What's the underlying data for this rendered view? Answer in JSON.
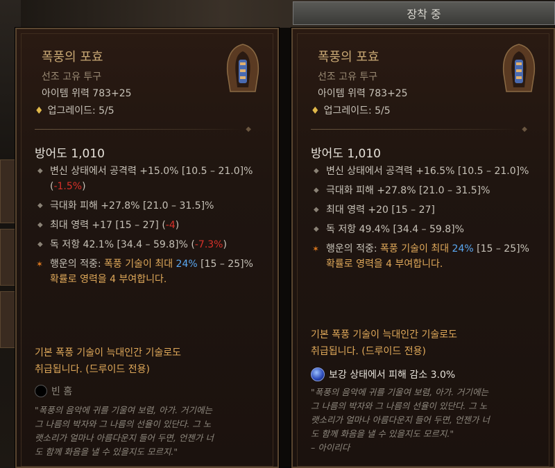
{
  "header": {
    "equipped_tab": "장착 중"
  },
  "left": {
    "title": "폭풍의 포효",
    "type": "선조 고유 투구",
    "power": "아이템 위력 783+25",
    "upgrade": "업그레이드: 5/5",
    "armor": "방어도 1,010",
    "stats": [
      {
        "pre": "변신 상태에서 공격력 +15.0% [10.5 – 21.0]% (",
        "diff": "-1.5%",
        "post": ")"
      },
      {
        "pre": "극대화 피해 +27.8% [21.0 – 31.5]%",
        "diff": "",
        "post": ""
      },
      {
        "pre": "최대 영력 +17 [15 – 27] (",
        "diff": "-4",
        "post": ")"
      },
      {
        "pre": "독 저항 42.1% [34.4 – 59.8]% (",
        "diff": "-7.3%",
        "post": ")"
      }
    ],
    "aspect_pre": "행운의 적중: ",
    "aspect_storm": "폭풍 기술이 최대 ",
    "aspect_pct": "24%",
    "aspect_mid": "[15 – 25]% ",
    "aspect_post": "확률로 영력을 4 부여합니다.",
    "druid_a": "기본 폭풍 기술이 늑대인간 기술로도",
    "druid_b": "취급됩니다. (드루이드 전용)",
    "socket": "빈 홈",
    "flavor": [
      "\"폭풍의 음악에 귀를 기울여 보렴, 아가. 거기에는",
      "그 나름의 박자와 그 나름의 선율이 있단다. 그 노",
      "랫소리가 얼마나 아름다운지 들어 두면, 언젠가 너",
      "도 함께 화음을 낼 수 있을지도 모르지.\""
    ]
  },
  "right": {
    "title": "폭풍의 포효",
    "type": "선조 고유 투구",
    "power": "아이템 위력 783+25",
    "upgrade": "업그레이드: 5/5",
    "armor": "방어도 1,010",
    "stats": [
      "변신 상태에서 공격력 +16.5% [10.5 – 21.0]%",
      "극대화 피해 +27.8% [21.0 – 31.5]%",
      "최대 영력 +20 [15 – 27]",
      "독 저항 49.4% [34.4 – 59.8]%"
    ],
    "aspect_pre": "행운의 적중: ",
    "aspect_storm": "폭풍 기술이 최대 ",
    "aspect_pct": "24%",
    "aspect_mid": "[15 – 25]% ",
    "aspect_post": "확률로 영력을 4 부여합니다.",
    "druid_a": "기본 폭풍 기술이 늑대인간 기술로도",
    "druid_b": "취급됩니다. (드루이드 전용)",
    "gem": "보강 상태에서 피해 감소 3.0%",
    "flavor": [
      "\"폭풍의 음악에 귀를 기울여 보렴, 아가. 거기에는",
      "그 나름의 박자와 그 나름의 선율이 있단다. 그 노",
      "랫소리가 얼마나 아름다운지 들어 두면, 언젠가 너",
      "도 함께 화음을 낼 수 있을지도 모르지.\"",
      "– 아이리다"
    ]
  }
}
